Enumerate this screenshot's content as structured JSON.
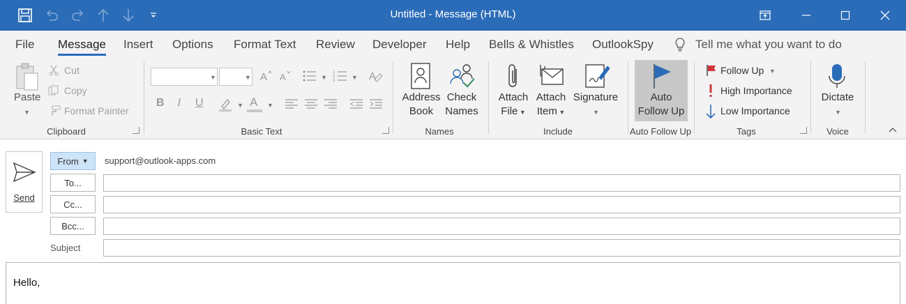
{
  "window": {
    "title": "Untitled  -  Message (HTML)"
  },
  "tabs": [
    "File",
    "Message",
    "Insert",
    "Options",
    "Format Text",
    "Review",
    "Developer",
    "Help",
    "Bells & Whistles",
    "OutlookSpy"
  ],
  "tell_me": "Tell me what you want to do",
  "clipboard": {
    "paste": "Paste",
    "cut": "Cut",
    "copy": "Copy",
    "format_painter": "Format Painter",
    "label": "Clipboard"
  },
  "basic_text": {
    "label": "Basic Text",
    "bold": "B",
    "italic": "I",
    "underline": "U",
    "font_color": "A"
  },
  "names": {
    "address_book": [
      "Address",
      "Book"
    ],
    "check_names": [
      "Check",
      "Names"
    ],
    "label": "Names"
  },
  "include": {
    "attach_file": [
      "Attach",
      "File"
    ],
    "attach_item": [
      "Attach",
      "Item"
    ],
    "signature": "Signature",
    "label": "Include"
  },
  "auto_follow_up": {
    "button": [
      "Auto",
      "Follow Up"
    ],
    "label": "Auto Follow Up"
  },
  "tags": {
    "follow_up": "Follow Up",
    "high_importance": "High Importance",
    "low_importance": "Low Importance",
    "label": "Tags"
  },
  "voice": {
    "dictate": "Dictate",
    "label": "Voice"
  },
  "compose": {
    "send": "Send",
    "from_button": "From",
    "from_value": "support@outlook-apps.com",
    "to_button": "To...",
    "cc_button": "Cc...",
    "bcc_button": "Bcc...",
    "subject_label": "Subject",
    "to_value": "",
    "cc_value": "",
    "bcc_value": "",
    "subject_value": "",
    "body": "Hello,"
  },
  "colors": {
    "titlebar": "#2b6cb8",
    "ribbon_bg": "#f3f3f3",
    "flag_red": "#d13438",
    "accent_blue": "#2b6cb8",
    "check_green": "#2e8b57"
  }
}
